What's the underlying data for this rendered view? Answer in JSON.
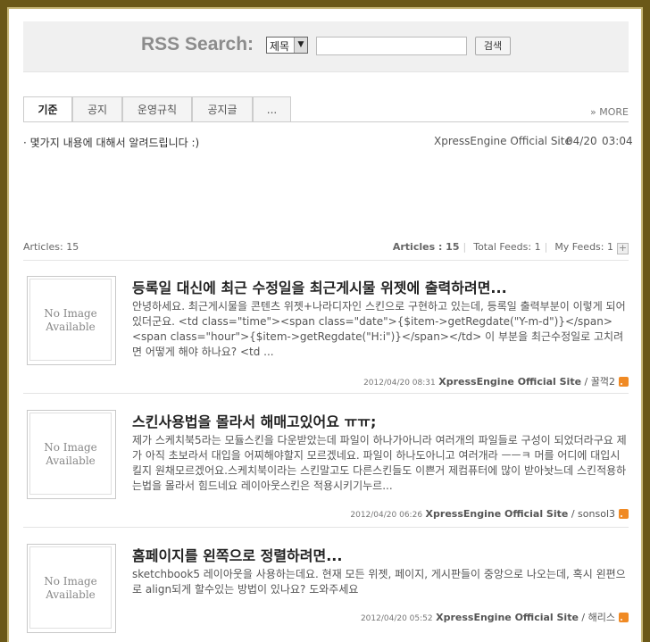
{
  "search": {
    "title": "RSS Search:",
    "select_value": "제목",
    "input_value": "",
    "button_label": "검색"
  },
  "tabs": [
    {
      "label": "기준"
    },
    {
      "label": "공지"
    },
    {
      "label": "운영규칙"
    },
    {
      "label": "공지글"
    },
    {
      "label": "..."
    }
  ],
  "more_label": "» MORE",
  "notice": {
    "text": "· 몇가지 내용에 대해서 알려드립니다 :)",
    "source": "XpressEngine Official Site",
    "date": "04/20",
    "time": "03:04"
  },
  "stats": {
    "articles_left": "Articles: 15",
    "articles_right": "Articles : 15",
    "total_feeds": "Total Feeds: 1",
    "my_feeds": "My Feeds: 1",
    "plus": "+"
  },
  "thumb_text": [
    "No Image",
    "Available"
  ],
  "entries": [
    {
      "title": "등록일 대신에 최근 수정일을 최근게시물 위젯에 출력하려면...",
      "body": "안녕하세요. 최근게시물을 콘텐츠 위젯+나라디자인 스킨으로 구현하고 있는데, 등록일 출력부분이 이렇게 되어 있더군요. <td class=\"time\"><span class=\"date\">{$item->getRegdate(\"Y-m-d\")}</span><span class=\"hour\">{$item->getRegdate(\"H:i\")}</span></td> 이 부분을 최근수정일로 고치려면 어떻게 해야 하나요? <td ...",
      "date": "2012/04/20 08:31",
      "source": "XpressEngine Official Site",
      "author": "꿀꺽2"
    },
    {
      "title": "스킨사용법을 몰라서 해매고있어요 ㅠㅠ;",
      "body": "제가 스케치북5라는 모듈스킨을 다운받았는데 파일이 하나가아니라 여러개의 파일들로 구성이 되었더라구요 제가 아직 초보라서 대입을 어찌해야할지 모르겠네요. 파일이 하나도아니고 여러개라 ㅡㅡㅋ 머를 어디에 대입시킬지 원채모르겠어요.스케치북이라는 스킨말고도 다른스킨들도 이쁜거 제컴퓨터에 많이 받아놧느데 스킨적용하는법을 몰라서 힘드네요 레이아웃스킨은 적용시키기누르...",
      "date": "2012/04/20 06:26",
      "source": "XpressEngine Official Site",
      "author": "sonsol3"
    },
    {
      "title": "홈페이지를 왼쪽으로 정렬하려면...",
      "body": "sketchbook5 레이아웃을 사용하는데요. 현재 모든 위젯, 페이지, 게시판들이 중앙으로 나오는데, 혹시 왼편으로 align되게 할수있는 방법이 있나요? 도와주세요",
      "date": "2012/04/20 05:52",
      "source": "XpressEngine Official Site",
      "author": "해리스"
    }
  ]
}
